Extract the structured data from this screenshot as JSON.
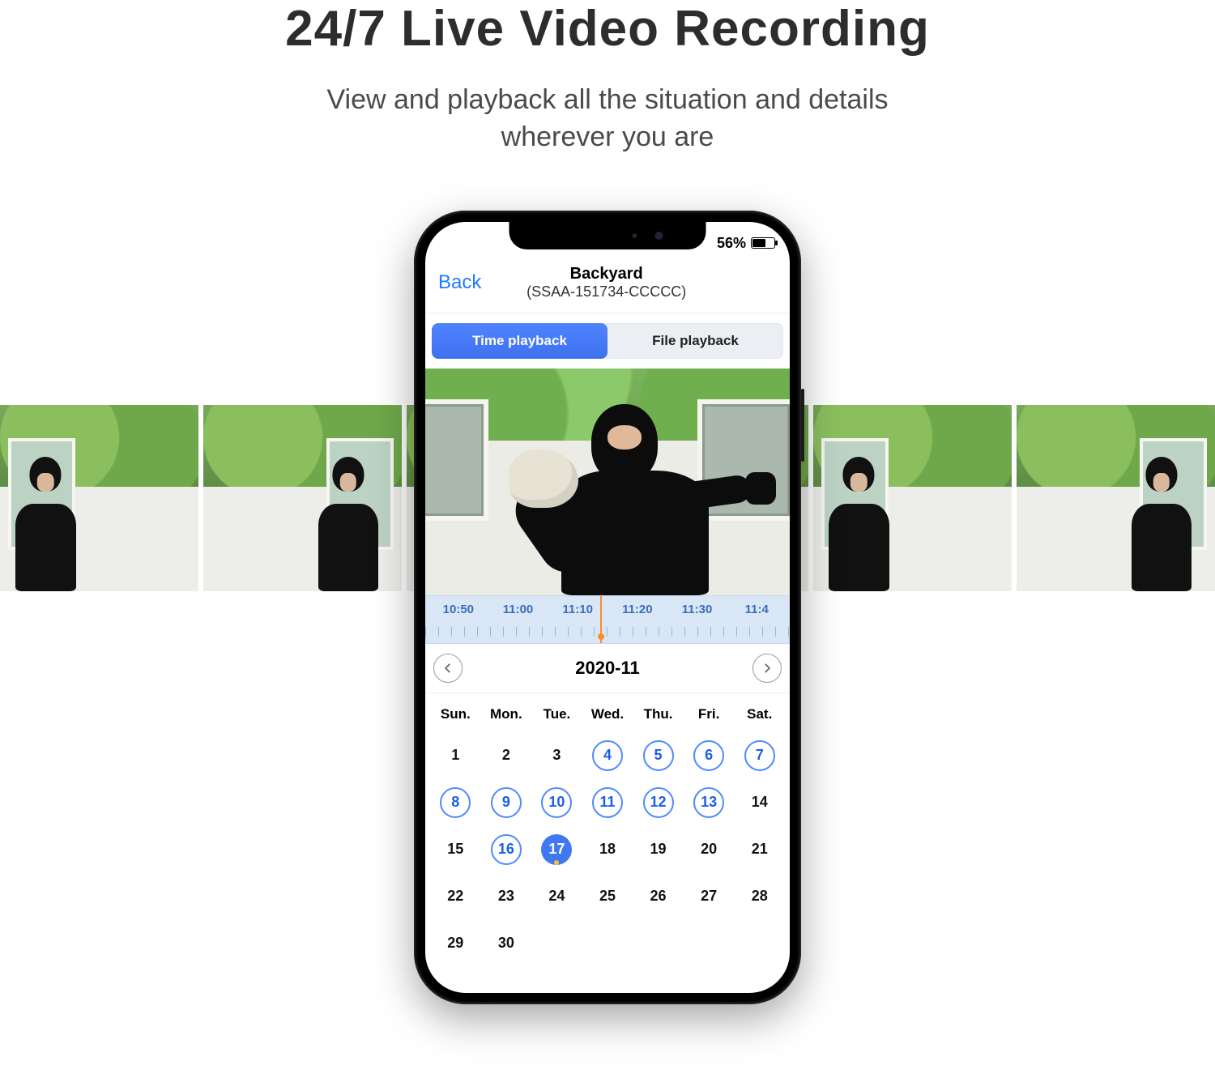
{
  "hero": {
    "title": "24/7 Live Video Recording",
    "subtitle_line1": "View and playback all the situation and details",
    "subtitle_line2": "wherever you are"
  },
  "statusbar": {
    "battery_text": "56%",
    "battery_percent": 56
  },
  "navbar": {
    "back": "Back",
    "title": "Backyard",
    "subtitle": "(SSAA-151734-CCCCC)"
  },
  "segmented": {
    "time": "Time playback",
    "file": "File playback",
    "active": "time"
  },
  "timeline": {
    "ticks": [
      "10:50",
      "11:00",
      "11:10",
      "11:20",
      "11:30",
      "11:4"
    ],
    "playhead_label": "11:10"
  },
  "month": {
    "label": "2020-11"
  },
  "calendar": {
    "dow": [
      "Sun.",
      "Mon.",
      "Tue.",
      "Wed.",
      "Thu.",
      "Fri.",
      "Sat."
    ],
    "weeks": [
      [
        {
          "n": 1
        },
        {
          "n": 2
        },
        {
          "n": 3
        },
        {
          "n": 4,
          "avail": true
        },
        {
          "n": 5,
          "avail": true
        },
        {
          "n": 6,
          "avail": true
        },
        {
          "n": 7,
          "avail": true
        }
      ],
      [
        {
          "n": 8,
          "avail": true
        },
        {
          "n": 9,
          "avail": true
        },
        {
          "n": 10,
          "avail": true
        },
        {
          "n": 11,
          "avail": true
        },
        {
          "n": 12,
          "avail": true
        },
        {
          "n": 13,
          "avail": true
        },
        {
          "n": 14
        }
      ],
      [
        {
          "n": 15
        },
        {
          "n": 16,
          "avail": true
        },
        {
          "n": 17,
          "avail": true,
          "selected": true
        },
        {
          "n": 18
        },
        {
          "n": 19
        },
        {
          "n": 20
        },
        {
          "n": 21
        }
      ],
      [
        {
          "n": 22
        },
        {
          "n": 23
        },
        {
          "n": 24
        },
        {
          "n": 25
        },
        {
          "n": 26
        },
        {
          "n": 27
        },
        {
          "n": 28
        }
      ],
      [
        {
          "n": 29
        },
        {
          "n": 30
        },
        {
          "n": ""
        },
        {
          "n": ""
        },
        {
          "n": ""
        },
        {
          "n": ""
        },
        {
          "n": ""
        }
      ]
    ]
  }
}
